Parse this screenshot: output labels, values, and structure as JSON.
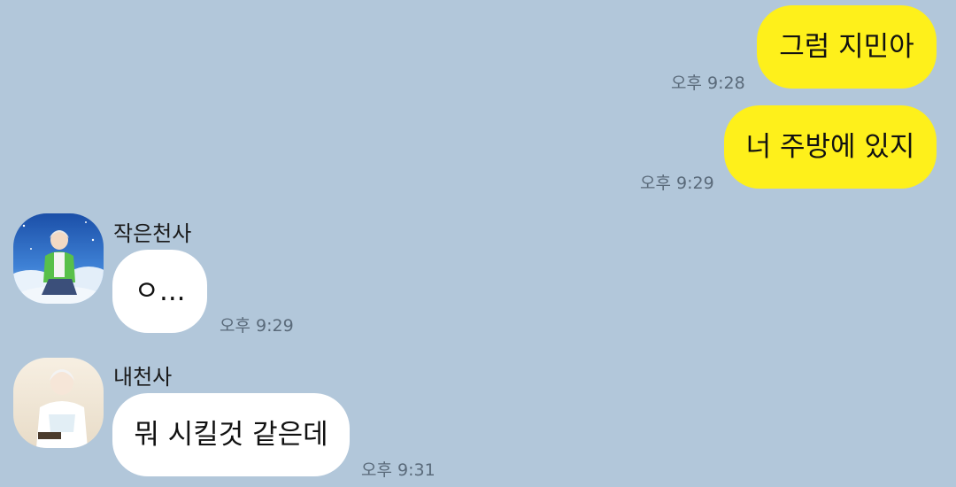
{
  "messages": [
    {
      "sender": "me",
      "text": "그럼 지민아",
      "time": "오후 9:28"
    },
    {
      "sender": "me",
      "text": "너 주방에 있지",
      "time": "오후 9:29"
    },
    {
      "sender": "작은천사",
      "text": "ㅇ...",
      "time": "오후 9:29",
      "avatar": "avatar-anime-boy-green-jacket"
    },
    {
      "sender": "내천사",
      "text": "뭐 시킬것 같은데",
      "time": "오후 9:31",
      "avatar": "avatar-anime-boy-white-hair"
    }
  ],
  "colors": {
    "background": "#b2c7da",
    "my_bubble": "#fef01b",
    "other_bubble": "#ffffff",
    "time_text": "#5a6a7a"
  }
}
